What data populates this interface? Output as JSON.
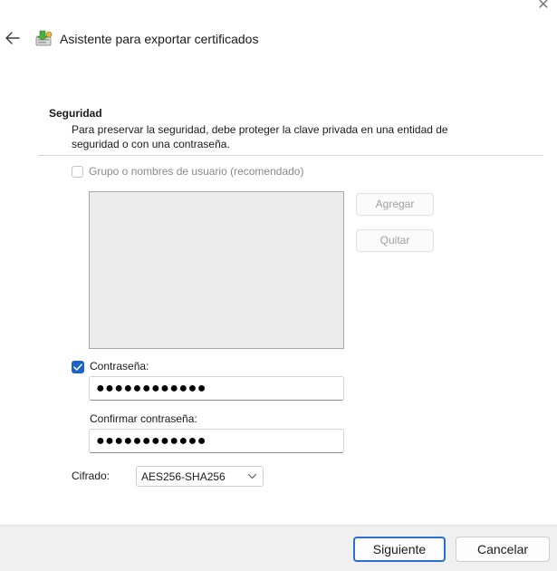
{
  "window": {
    "title": "Asistente para exportar certificados",
    "close_glyph": "✕"
  },
  "icons": {
    "back": "arrow-left-icon",
    "app": "certificate-export-icon",
    "check": "checkmark-icon",
    "dropdown": "chevron-down-icon"
  },
  "colors": {
    "accent": "#1b63c7",
    "primary_border": "#2a6fd1",
    "footer_bg": "#f0f0f0"
  },
  "security": {
    "title": "Seguridad",
    "description": "Para preservar la seguridad, debe proteger la clave privada en una entidad de seguridad o con una contraseña."
  },
  "group_option": {
    "label": "Grupo o nombres de usuario (recomendado)",
    "checked": false,
    "enabled": false
  },
  "buttons": {
    "add": "Agregar",
    "remove": "Quitar",
    "next": "Siguiente",
    "cancel": "Cancelar"
  },
  "password_option": {
    "label": "Contraseña:",
    "checked": true,
    "value_masked": "●●●●●●●●●●●●"
  },
  "confirm_password": {
    "label": "Confirmar contraseña:",
    "value_masked": "●●●●●●●●●●●●"
  },
  "encryption": {
    "label": "Cifrado:",
    "selected": "AES256-SHA256"
  }
}
